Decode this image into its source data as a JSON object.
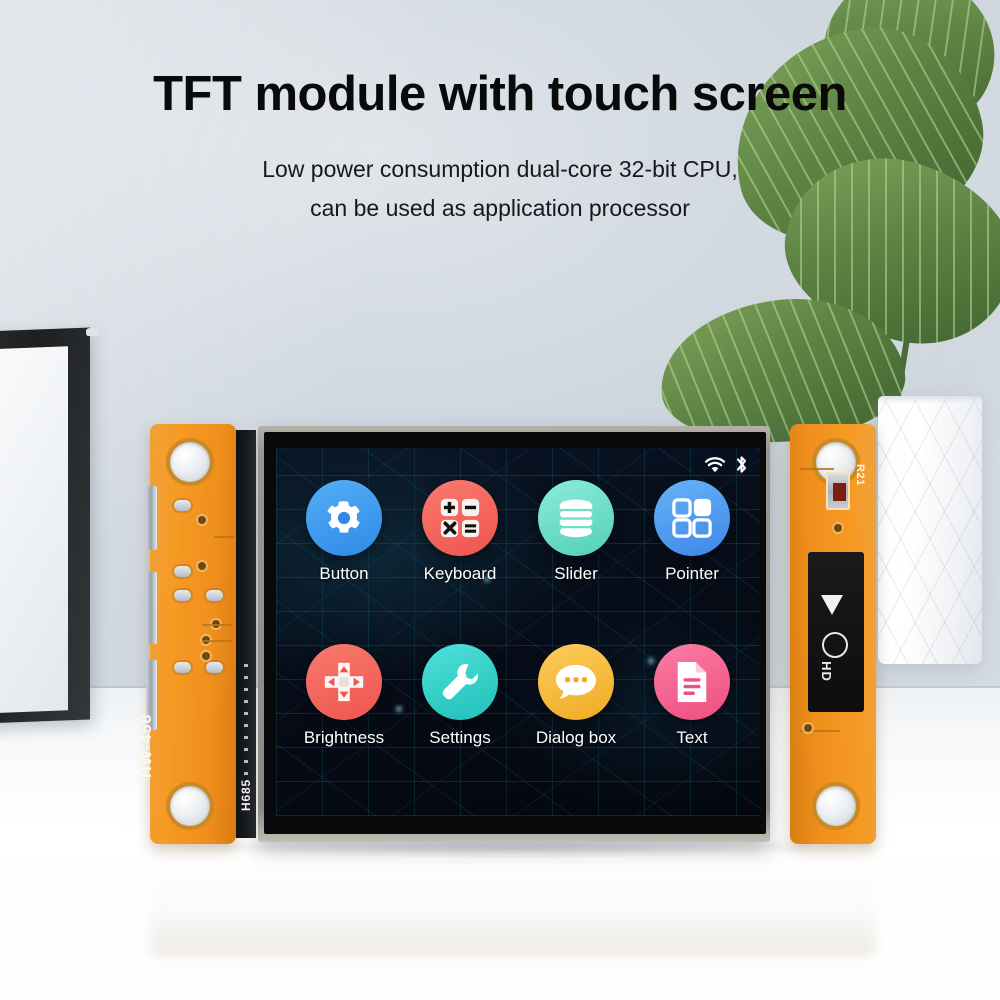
{
  "headline": "TFT module with touch screen",
  "subtitle_line1": "Low power consumption dual-core 32-bit CPU,",
  "subtitle_line2": "can be used as application processor",
  "board": {
    "left_silkscreen": "HW-458",
    "left_strip_label": "H685",
    "right_silkscreen": "R21",
    "chip_label": "HD",
    "pcb_color": "#ef8f1c",
    "bezel_color": "#9b968f"
  },
  "screen": {
    "background_color": "#070d18",
    "trace_color": "#28bec8",
    "statusbar": {
      "wifi_icon": "wifi-icon",
      "bluetooth_icon": "bluetooth-icon",
      "icon_color": "#ffffff"
    },
    "apps": [
      {
        "label": "Button",
        "icon": "gear-icon",
        "color": "#3d9cf0"
      },
      {
        "label": "Keyboard",
        "icon": "calculator-icon",
        "color": "#f4655e"
      },
      {
        "label": "Slider",
        "icon": "database-icon",
        "color": "#6fe0c8"
      },
      {
        "label": "Pointer",
        "icon": "grid-squares-icon",
        "color": "#4d9df0"
      },
      {
        "label": "Brightness",
        "icon": "dpad-icon",
        "color": "#f4655e"
      },
      {
        "label": "Settings",
        "icon": "wrench-icon",
        "color": "#2fd3cb"
      },
      {
        "label": "Dialog box",
        "icon": "speech-bubble-icon",
        "color": "#f7bb3a"
      },
      {
        "label": "Text",
        "icon": "document-icon",
        "color": "#f4628f"
      }
    ]
  },
  "scene": {
    "wall_color": "#d2d9e1",
    "table_color": "#ffffff",
    "frame_color": "#24262a",
    "plant_leaf_color": "#5d8444",
    "vase_color": "#ffffff"
  }
}
